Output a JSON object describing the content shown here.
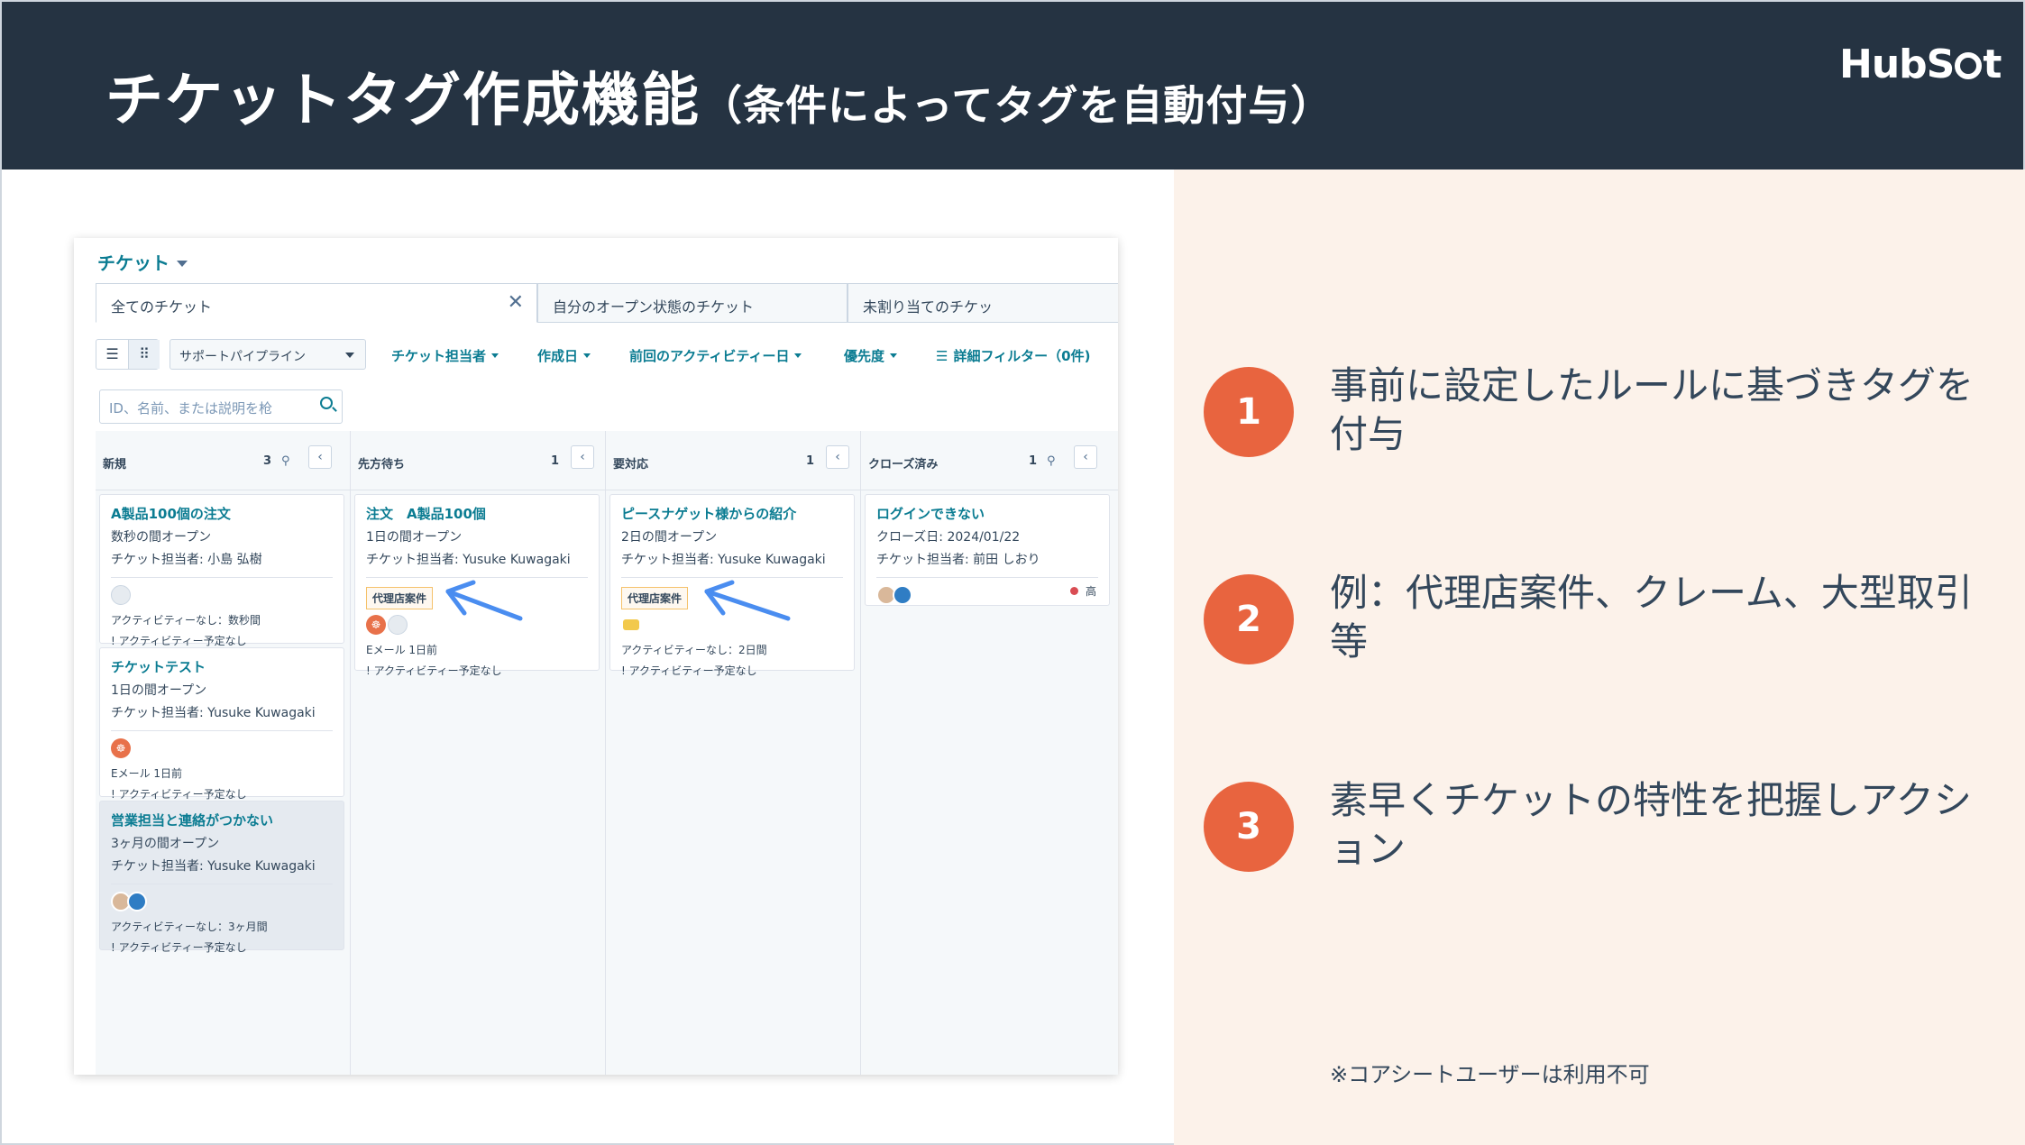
{
  "slide": {
    "title_main": "チケットタグ作成機能",
    "title_sub": "（条件によってタグを自動付与）",
    "logo_part1": "HubS",
    "logo_part2": "t"
  },
  "app": {
    "object_title": "チケット",
    "tabs": [
      "全てのチケット",
      "自分のオープン状態のチケット",
      "未割り当てのチケッ"
    ],
    "pipeline_select": "サポートパイプライン",
    "filters": [
      "チケット担当者",
      "作成日",
      "前回のアクティビティー日",
      "優先度"
    ],
    "advanced_filter": "詳細フィルター（0件)",
    "search_placeholder": "ID、名前、または説明を枪"
  },
  "columns": [
    {
      "name": "新規",
      "count": "3",
      "cards": [
        {
          "title": "A製品100個の注文",
          "line1": "数秒の間オープン",
          "line2": "チケット担当者: 小島 弘樹",
          "activity": "アクティビティーなし：数秒間",
          "scheduled": "! アクティビティー予定なし"
        },
        {
          "title": "チケットテスト",
          "line1": "1日の間オープン",
          "line2": "チケット担当者: Yusuke Kuwagaki",
          "activity": "Eメール 1日前",
          "scheduled": "! アクティビティー予定なし"
        },
        {
          "title": "営業担当と連絡がつかない",
          "line1": "3ヶ月の間オープン",
          "line2": "チケット担当者: Yusuke Kuwagaki",
          "activity": "アクティビティーなし：3ヶ月間",
          "scheduled": "! アクティビティー予定なし"
        }
      ]
    },
    {
      "name": "先方待ち",
      "count": "1",
      "cards": [
        {
          "title": "注文　A製品100個",
          "line1": "1日の間オープン",
          "line2": "チケット担当者: Yusuke Kuwagaki",
          "tag": "代理店案件",
          "activity": "Eメール 1日前",
          "scheduled": "! アクティビティー予定なし"
        }
      ]
    },
    {
      "name": "要対応",
      "count": "1",
      "cards": [
        {
          "title": "ピースナゲット様からの紹介",
          "line1": "2日の間オープン",
          "line2": "チケット担当者: Yusuke Kuwagaki",
          "tag": "代理店案件",
          "activity": "アクティビティーなし：2日間",
          "scheduled": "! アクティビティー予定なし"
        }
      ]
    },
    {
      "name": "クローズ済み",
      "count": "1",
      "cards": [
        {
          "title": "ログインできない",
          "line1": "クローズ日: 2024/01/22",
          "line2": "チケット担当者: 前田 しおり",
          "priority": "高"
        }
      ]
    }
  ],
  "points": [
    {
      "num": "1",
      "text": "事前に設定したルールに基づきタグを付与"
    },
    {
      "num": "2",
      "text": "例：代理店案件、クレーム、大型取引等"
    },
    {
      "num": "3",
      "text": "素早くチケットの特性を把握しアクション"
    }
  ],
  "note": "※コアシートユーザーは利用不可",
  "colors": {
    "header_bg": "#253342",
    "accent": "#e8643f",
    "panel_bg": "#fcf2ea",
    "link": "#0b7c92",
    "arrow": "#4a8df0"
  }
}
